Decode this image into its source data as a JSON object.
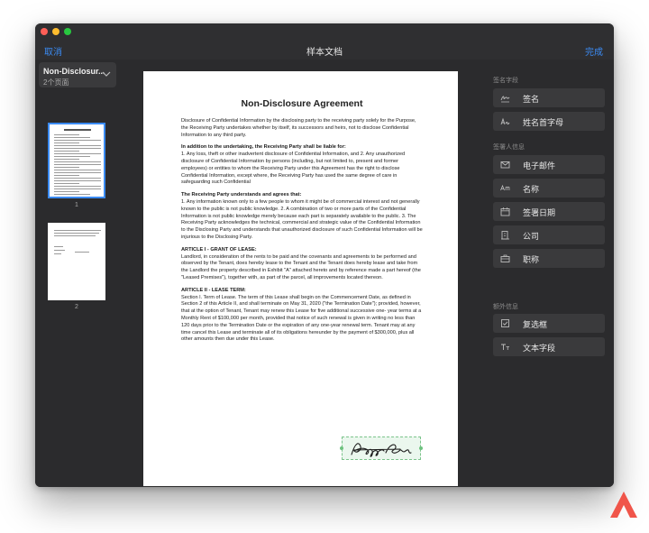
{
  "window": {
    "title": "样本文档",
    "cancel_label": "取消",
    "done_label": "完成"
  },
  "sidebar": {
    "document_name": "Non-Disclosur...",
    "page_count": "2个页面",
    "thumbnails": [
      {
        "number": "1",
        "selected": true
      },
      {
        "number": "2",
        "selected": false
      }
    ]
  },
  "document": {
    "title": "Non-Disclosure Agreement",
    "paragraphs": [
      {
        "heading": "",
        "text": "Disclosure of Confidential Information by the disclosing party to the receiving party solely for the Purpose, the Receiving Party undertakes whether by itself, its successors and heirs, not to disclose Confidential Information to any third party."
      },
      {
        "heading": "In addition to the undertaking, the Receiving Party shall be liable for:",
        "text": "1. Any loss, theft or other inadvertent disclosure of Confidential Information, and 2. Any unauthorized disclosure of Confidential Information by persons (including, but not limited to, present and former employees) or entities to whom the Receiving Party under this Agreement has the right to disclose Confidential Information, except where, the Receiving Party has used the same degree of care in safeguarding such Confidential"
      },
      {
        "heading": "The Receiving Party understands and agrees that:",
        "text": "1. Any information known only to a few people to whom it might be of commercial interest and not generally known to the public is not public knowledge. 2. A combination of two or more parts of the Confidential Information is not public knowledge merely because each part is separately available to the public. 3. The Receiving Party acknowledges the technical, commercial and strategic value of the Confidential Information to the Disclosing Party and understands that unauthorized disclosure of such Confidential Information will be injurious to the Disclosing Party."
      },
      {
        "heading": "ARTICLE I - GRANT OF LEASE:",
        "text": "Landlord, in consideration of the rents to be paid and the covenants and agreements to be performed and observed by the Tenant, does hereby lease to the Tenant and the Tenant does hereby lease and take from the Landlord the property described in Exhibit \"A\" attached hereto and by reference made a part hereof (the \"Leased Premises\"), together with, as part of the parcel, all improvements located thereon."
      },
      {
        "heading": "ARTICLE II - LEASE TERM:",
        "text": "Section l. Term of Lease. The term of this Lease shall begin on the Commencement Date, as defined in Section 2 of this Article II, and shall terminate on May 31, 2020 (\"the Termination Date\"); provided, however, that at the option of Tenant, Tenant may renew this Lease for five additional successive one- year terms at a Monthly Rent of $100,000 per month, provided that notice of such renewal is given in writing no less than 120 days prior to the Termination Date or the expiration of any one-year renewal term. Tenant may at any time cancel this Lease and terminate all of its obligations hereunder by the payment of $300,000, plus all other amounts then due under this Lease."
      }
    ]
  },
  "fields": {
    "signature_section": "签名字段",
    "signature_items": [
      {
        "label": "签名",
        "icon": "signature-icon"
      },
      {
        "label": "姓名首字母",
        "icon": "initials-icon"
      }
    ],
    "signer_section": "签署人信息",
    "signer_items": [
      {
        "label": "电子邮件",
        "icon": "email-icon"
      },
      {
        "label": "名称",
        "icon": "name-icon"
      },
      {
        "label": "签署日期",
        "icon": "date-icon"
      },
      {
        "label": "公司",
        "icon": "company-icon"
      },
      {
        "label": "职称",
        "icon": "briefcase-icon"
      }
    ],
    "extra_section": "额外信息",
    "extra_items": [
      {
        "label": "复选框",
        "icon": "checkbox-icon"
      },
      {
        "label": "文本字段",
        "icon": "text-field-icon"
      }
    ]
  },
  "colors": {
    "accent": "#3b8bf3",
    "window_bg": "#2b2b2d",
    "button_bg": "#3a3a3c",
    "signature_highlight": "#7cc48c",
    "logo": "#f0554a"
  }
}
